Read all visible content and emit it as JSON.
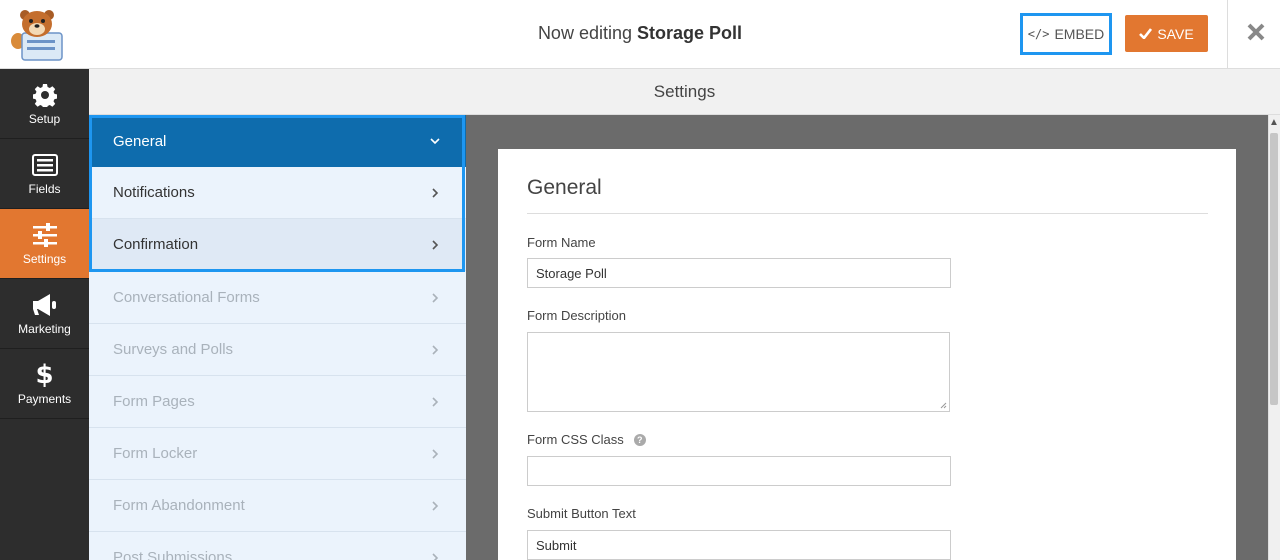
{
  "header": {
    "title_prefix": "Now editing",
    "form_name": "Storage Poll",
    "embed_label": "EMBED",
    "embed_code_glyph": "</>",
    "save_label": "SAVE",
    "close_glyph": "✖",
    "accent_color": "#e27730",
    "highlight_color": "#1e96f0"
  },
  "leftnav": {
    "items": [
      {
        "label": "Setup",
        "icon": "gear-icon"
      },
      {
        "label": "Fields",
        "icon": "list-icon"
      },
      {
        "label": "Settings",
        "icon": "sliders-icon",
        "active": true
      },
      {
        "label": "Marketing",
        "icon": "megaphone-icon"
      },
      {
        "label": "Payments",
        "icon": "dollar-icon"
      }
    ]
  },
  "settings": {
    "title": "Settings",
    "panels": [
      {
        "label": "General",
        "active": true
      },
      {
        "label": "Notifications"
      },
      {
        "label": "Confirmation"
      },
      {
        "label": "Conversational Forms"
      },
      {
        "label": "Surveys and Polls"
      },
      {
        "label": "Form Pages"
      },
      {
        "label": "Form Locker"
      },
      {
        "label": "Form Abandonment"
      },
      {
        "label": "Post Submissions"
      }
    ]
  },
  "general": {
    "title": "General",
    "form_name_label": "Form Name",
    "form_name_value": "Storage Poll",
    "form_description_label": "Form Description",
    "form_css_class_label": "Form CSS Class",
    "help_glyph": "?",
    "submit_button_text_label": "Submit Button Text",
    "submit_button_text_value": "Submit"
  }
}
